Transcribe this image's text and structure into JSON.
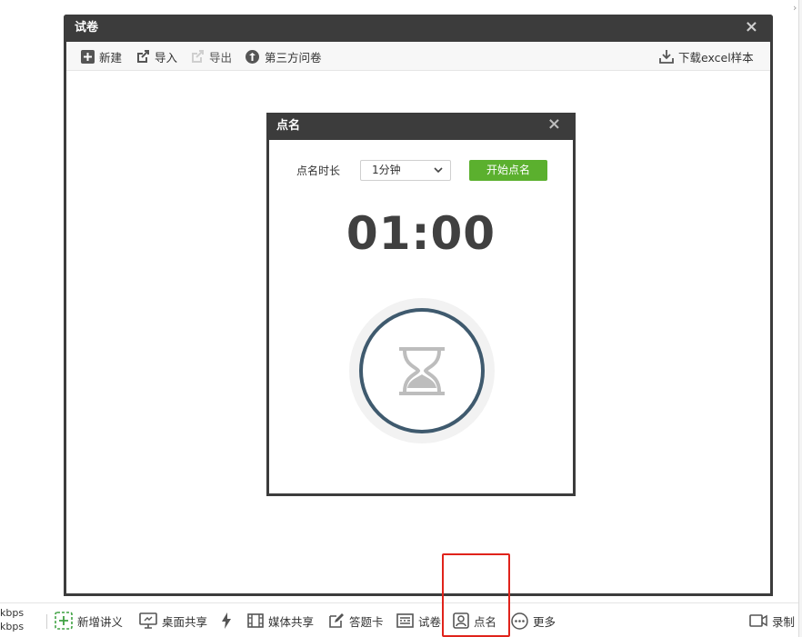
{
  "outer_dialog": {
    "title": "试卷",
    "close": "×",
    "toolbar": {
      "new_label": "新建",
      "import_label": "导入",
      "export_label": "导出",
      "third_party_label": "第三方问卷",
      "download_label": "下载excel样本"
    }
  },
  "rollcall_dialog": {
    "title": "点名",
    "close": "×",
    "duration_label": "点名时长",
    "duration_selected": "1分钟",
    "start_label": "开始点名",
    "timer": "01:00"
  },
  "bottom_bar": {
    "kbps_top": "kbps",
    "kbps_bottom": "kbps",
    "add_lecture": "新增讲义",
    "desktop_share": "桌面共享",
    "media_share": "媒体共享",
    "answer_card": "答题卡",
    "exam": "试卷",
    "rollcall": "点名",
    "more": "更多",
    "record": "录制"
  },
  "colors": {
    "title_bar": "#3c3c3c",
    "start_button": "#5bb02e",
    "accent_green": "#3fa142",
    "highlight_red": "#e0231b",
    "ring": "#3f5a6e"
  },
  "icons": {
    "toolbar": [
      "plus-square-icon",
      "import-icon",
      "export-icon",
      "third-party-icon",
      "download-icon"
    ],
    "bottom": [
      "add-icon",
      "monitor-icon",
      "lightning-icon",
      "film-icon",
      "edit-icon",
      "exam-icon",
      "rollcall-icon",
      "more-icon",
      "video-camera-icon"
    ],
    "center": "hourglass-icon"
  }
}
